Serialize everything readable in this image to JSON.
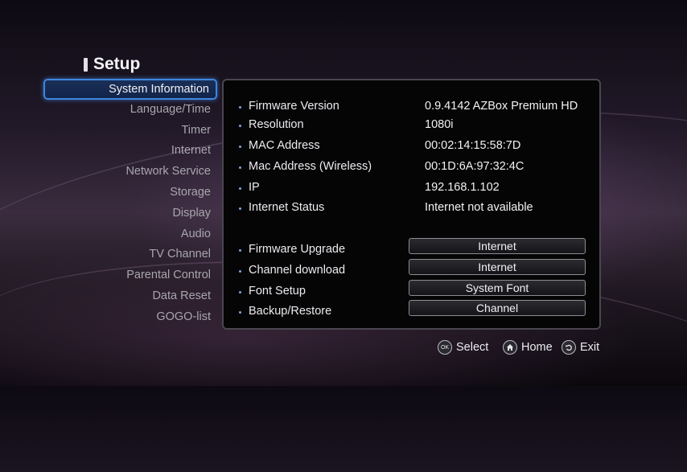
{
  "header": {
    "title": "Setup"
  },
  "menu": {
    "items": [
      {
        "label": "System Information"
      },
      {
        "label": "Language/Time"
      },
      {
        "label": "Timer"
      },
      {
        "label": "Internet"
      },
      {
        "label": "Network Service"
      },
      {
        "label": "Storage"
      },
      {
        "label": "Display"
      },
      {
        "label": "Audio"
      },
      {
        "label": "TV Channel"
      },
      {
        "label": "Parental Control"
      },
      {
        "label": "Data Reset"
      },
      {
        "label": "GOGO-list"
      }
    ],
    "selected": "System Information"
  },
  "info": {
    "rows": [
      {
        "label": "Firmware Version",
        "value": "0.9.4142 AZBox Premium HD"
      },
      {
        "label": "Resolution",
        "value": "1080i"
      },
      {
        "label": "MAC Address",
        "value": "00:02:14:15:58:7D"
      },
      {
        "label": "Mac Address (Wireless)",
        "value": "00:1D:6A:97:32:4C"
      },
      {
        "label": "IP",
        "value": "192.168.1.102"
      },
      {
        "label": "Internet Status",
        "value": "Internet not available"
      }
    ]
  },
  "actions": {
    "rows": [
      {
        "label": "Firmware Upgrade",
        "button": "Internet"
      },
      {
        "label": "Channel download",
        "button": "Internet"
      },
      {
        "label": "Font Setup",
        "button": "System Font"
      },
      {
        "label": "Backup/Restore",
        "button": "Channel"
      }
    ]
  },
  "footer": {
    "select": {
      "icon": "ok-icon",
      "icon_text": "OK",
      "label": "Select"
    },
    "home": {
      "icon": "home-icon",
      "label": "Home"
    },
    "exit": {
      "icon": "back-arrow-icon",
      "label": "Exit"
    }
  },
  "colors": {
    "selection_border": "#3f86e0",
    "selection_fill": "#16284f",
    "panel_background": "#050506",
    "bullet": "#7fa6d8"
  }
}
